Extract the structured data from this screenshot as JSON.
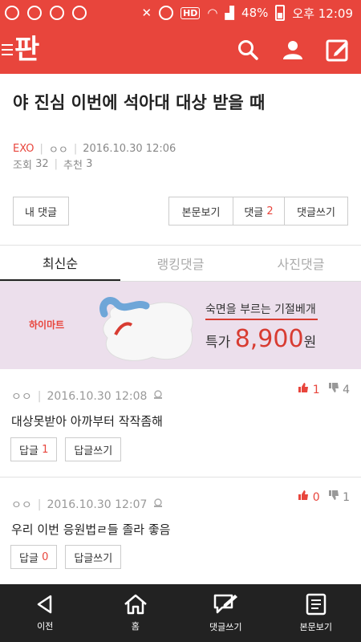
{
  "status_bar": {
    "battery": "48%",
    "time": "오후 12:09",
    "hd_label": "HD"
  },
  "app": {
    "logo": "판"
  },
  "post": {
    "title": "야 진심 이번에 석아대 대상 받을 때",
    "author_channel": "EXO",
    "author": "ㅇㅇ",
    "date": "2016.10.30 12:06",
    "views_label": "조회",
    "views": "32",
    "recommend_label": "추천",
    "recommend": "3"
  },
  "actions": {
    "my_comments": "내 댓글",
    "view_post": "본문보기",
    "comments_label": "댓글",
    "comments_count": "2",
    "write_comment": "댓글쓰기"
  },
  "tabs": [
    {
      "label": "최신순",
      "active": true
    },
    {
      "label": "랭킹댓글",
      "active": false
    },
    {
      "label": "사진댓글",
      "active": false
    }
  ],
  "ad": {
    "brand": "하이마트",
    "line1": "숙면을 부르는 기절베개",
    "special_label": "특가",
    "price": "8,900",
    "unit": "원"
  },
  "comments": [
    {
      "author": "ㅇㅇ",
      "date": "2016.10.30 12:08",
      "text": "대상못받아 아까부터 작작좀해",
      "reply_label": "답글",
      "reply_count": "1",
      "write_reply": "답글쓰기",
      "up": "1",
      "down": "4"
    },
    {
      "author": "ㅇㅇ",
      "date": "2016.10.30 12:07",
      "text": "우리 이번 응원법ㄹ들 졸라 좋음",
      "reply_label": "답글",
      "reply_count": "0",
      "write_reply": "답글쓰기",
      "up": "0",
      "down": "1"
    }
  ],
  "bottom_nav": [
    {
      "label": "이전",
      "icon": "back-icon"
    },
    {
      "label": "홈",
      "icon": "home-icon"
    },
    {
      "label": "댓글쓰기",
      "icon": "write-comment-icon"
    },
    {
      "label": "본문보기",
      "icon": "document-icon"
    }
  ],
  "colors": {
    "brand": "#e8453c",
    "nav_bg": "#222222",
    "ad_bg": "#ecdfec"
  }
}
